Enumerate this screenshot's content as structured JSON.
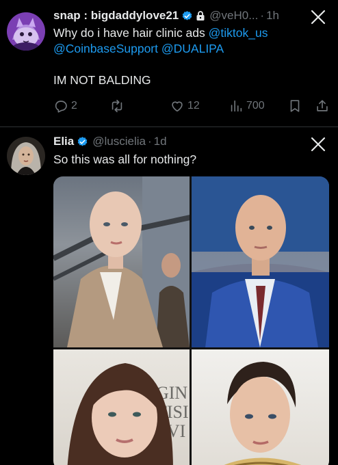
{
  "tweet1": {
    "name": "snap : bigdaddylove21",
    "handle": "@veH0...",
    "sep": "·",
    "time": "1h",
    "body_line1": "Why do i have hair clinic ads ",
    "mention1": "@tiktok_us",
    "mention2": "@CoinbaseSupport",
    "mention3": "@DUALIPA",
    "body_para2": "IM NOT BALDING",
    "stats": {
      "replies": "2",
      "likes": "12",
      "views": "700"
    }
  },
  "tweet2": {
    "name": "Elia",
    "handle": "@luscielia",
    "sep": "·",
    "time": "1d",
    "body": "So this was all for nothing?",
    "sign_text_line1": "GIN M",
    "sign_text_line2": "TISI",
    "sign_text_line3": "EVI"
  },
  "colors": {
    "accent": "#1d9bf0",
    "muted": "#71767b",
    "text": "#e7e9ea",
    "background": "#000000"
  },
  "icons": [
    "verified-badge-icon",
    "lock-icon",
    "close-icon",
    "reply-icon",
    "retweet-icon",
    "like-icon",
    "views-icon",
    "bookmark-icon",
    "share-icon"
  ]
}
